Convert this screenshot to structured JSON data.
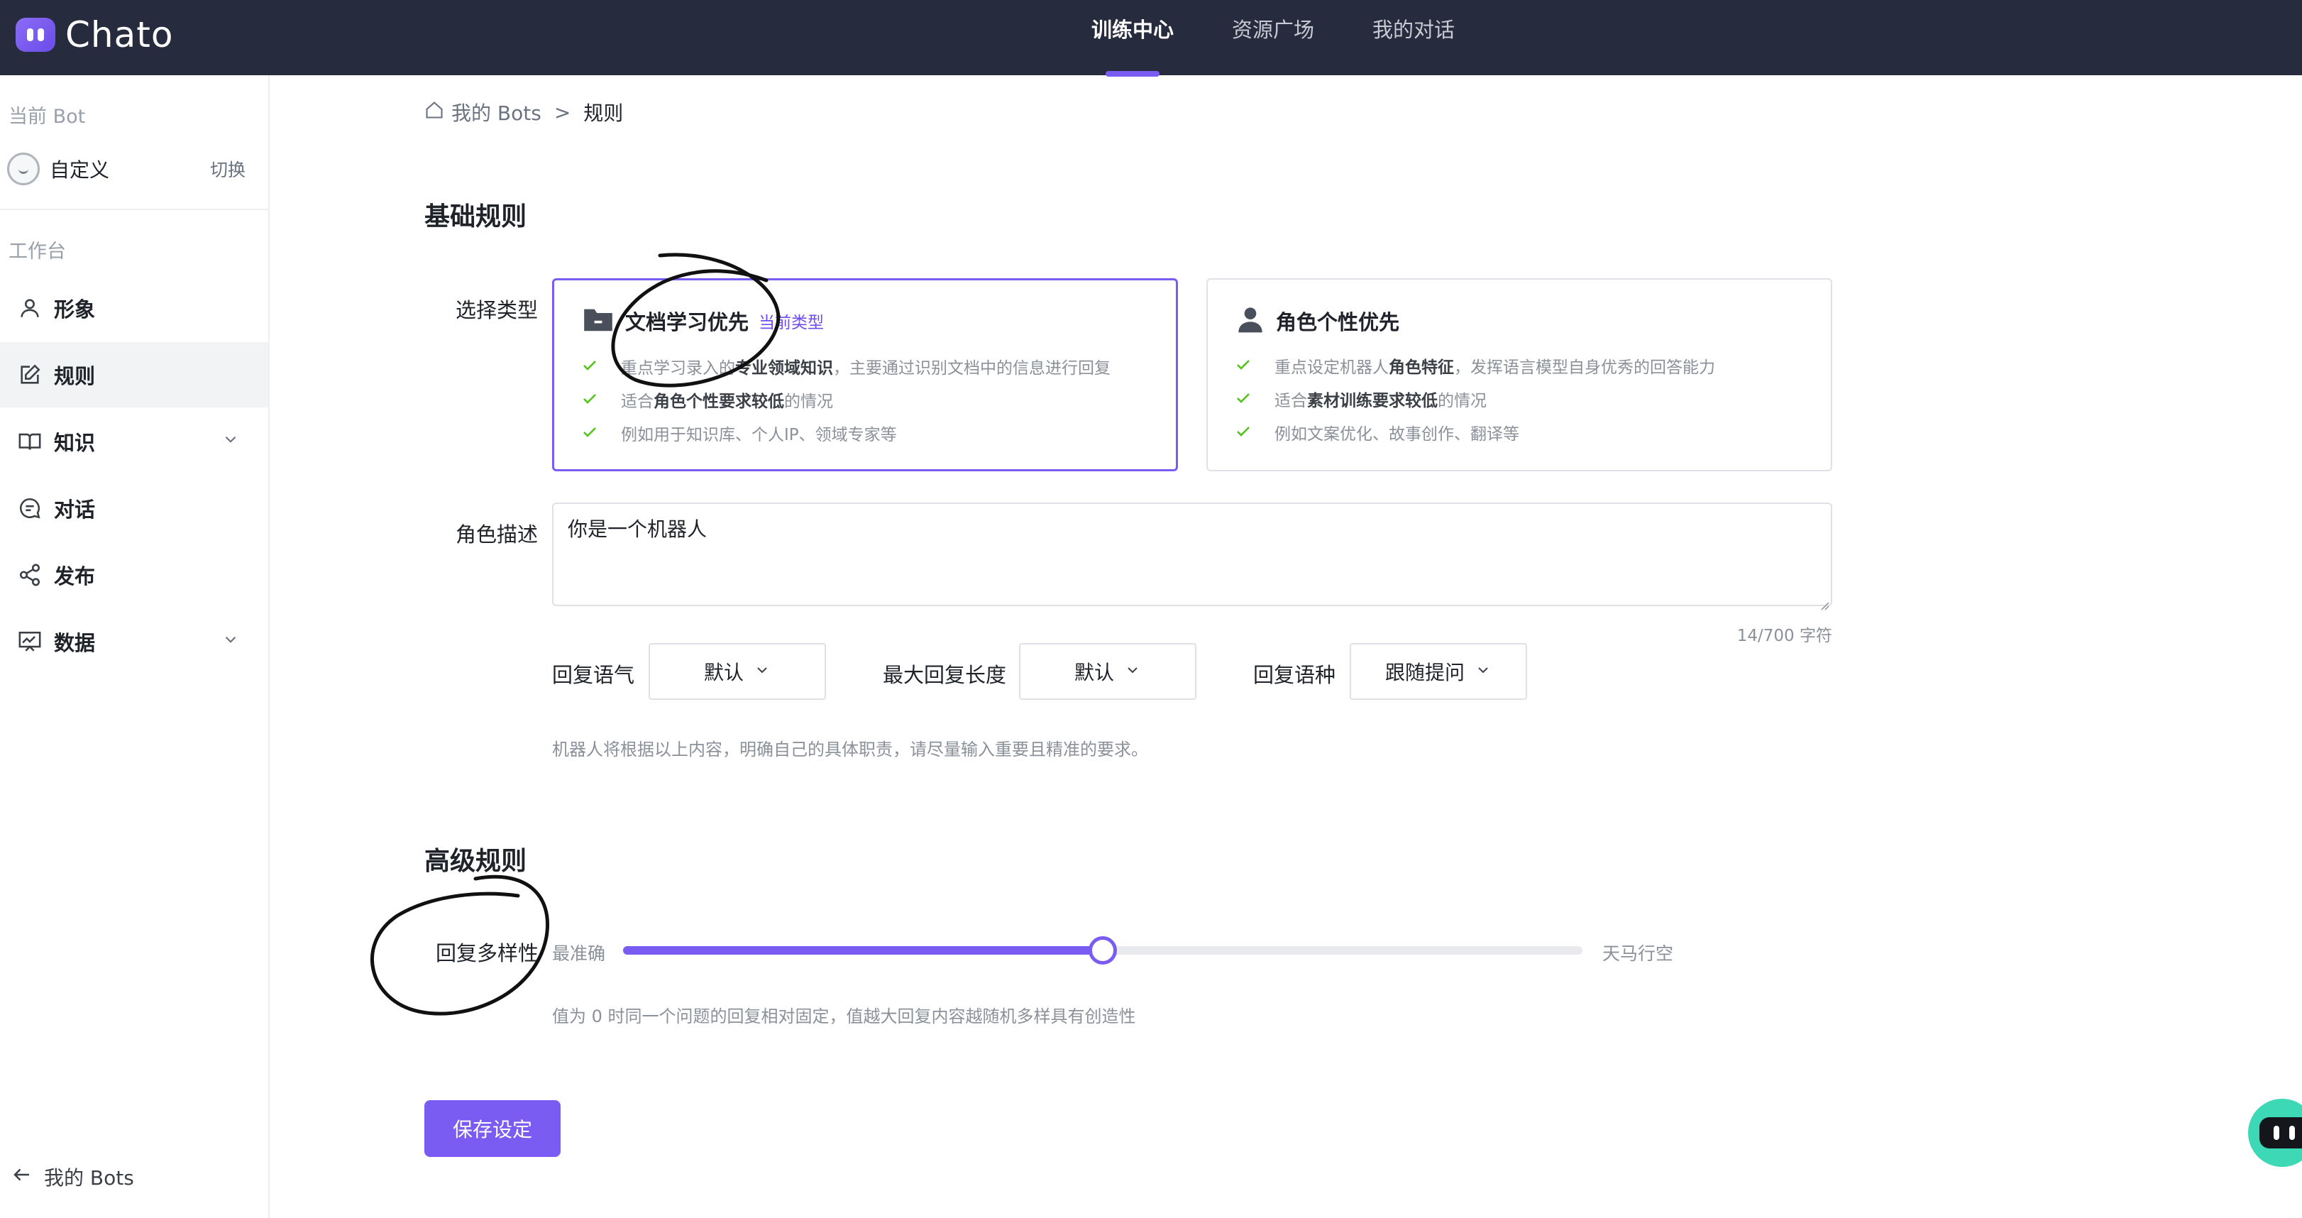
{
  "app": {
    "logo_text": "Chato"
  },
  "topnav": {
    "items": [
      {
        "label": "训练中心",
        "active": true
      },
      {
        "label": "资源广场",
        "active": false
      },
      {
        "label": "我的对话",
        "active": false
      }
    ]
  },
  "sidebar": {
    "current_bot_label": "当前 Bot",
    "bot_name": "自定义",
    "switch_label": "切换",
    "workspace_label": "工作台",
    "menu": [
      {
        "label": "形象",
        "icon": "user-icon",
        "active": false,
        "expandable": false
      },
      {
        "label": "规则",
        "icon": "edit-icon",
        "active": true,
        "expandable": false
      },
      {
        "label": "知识",
        "icon": "book-icon",
        "active": false,
        "expandable": true
      },
      {
        "label": "对话",
        "icon": "chat-icon",
        "active": false,
        "expandable": false
      },
      {
        "label": "发布",
        "icon": "share-icon",
        "active": false,
        "expandable": false
      },
      {
        "label": "数据",
        "icon": "chart-icon",
        "active": false,
        "expandable": true
      }
    ],
    "back_label": "我的 Bots"
  },
  "breadcrumb": {
    "parent": "我的 Bots",
    "separator": ">",
    "current": "规则"
  },
  "basic_rules": {
    "title": "基础规则",
    "type_label": "选择类型",
    "cards": [
      {
        "title": "文档学习优先",
        "tag": "当前类型",
        "icon": "folder-icon",
        "selected": true,
        "lines": [
          {
            "before": "重点学习录入的",
            "bold": "专业领域知识",
            "after": "，主要通过识别文档中的信息进行回复"
          },
          {
            "before": "适合",
            "bold": "角色个性要求较低",
            "after": "的情况"
          },
          {
            "before": "例如用于知识库、个人IP、领域专家等",
            "bold": "",
            "after": ""
          }
        ]
      },
      {
        "title": "角色个性优先",
        "tag": "",
        "icon": "person-icon",
        "selected": false,
        "lines": [
          {
            "before": "重点设定机器人",
            "bold": "角色特征",
            "after": "，发挥语言模型自身优秀的回答能力"
          },
          {
            "before": "适合",
            "bold": "素材训练要求较低",
            "after": "的情况"
          },
          {
            "before": "例如文案优化、故事创作、翻译等",
            "bold": "",
            "after": ""
          }
        ]
      }
    ],
    "role_label": "角色描述",
    "role_value": "你是一个机器人",
    "char_count": "14/700 字符",
    "selects": [
      {
        "label": "回复语气",
        "value": "默认"
      },
      {
        "label": "最大回复长度",
        "value": "默认"
      },
      {
        "label": "回复语种",
        "value": "跟随提问"
      }
    ],
    "hint": "机器人将根据以上内容，明确自己的具体职责，请尽量输入重要且精准的要求。"
  },
  "advanced_rules": {
    "title": "高级规则",
    "diversity_label": "回复多样性",
    "min_label": "最准确",
    "max_label": "天马行空",
    "value": 0.5,
    "hint": "值为 0 时同一个问题的回复相对固定，值越大回复内容越随机多样具有创造性"
  },
  "save_label": "保存设定",
  "colors": {
    "accent": "#7b5cf2",
    "topbar": "#262b3d",
    "check": "#52c41a",
    "assistant": "#3dd9b6"
  }
}
